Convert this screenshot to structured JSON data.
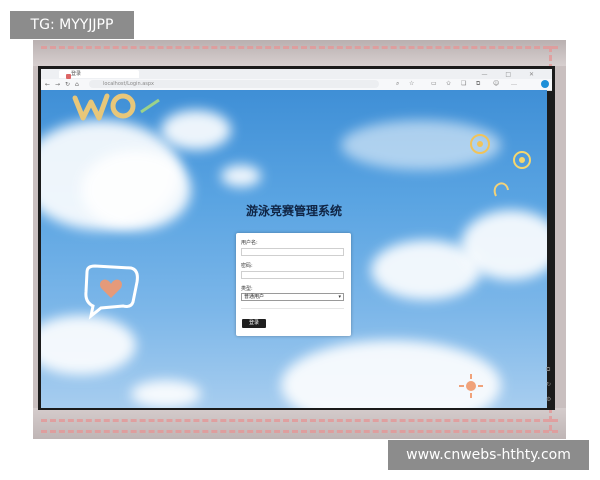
{
  "badge": {
    "text": "TG: MYYJJPP"
  },
  "watermark": {
    "text": "www.cnwebs-hthty.com"
  },
  "browser": {
    "tab_title": "登录",
    "address_text": "localhost/Login.aspx",
    "window_controls": [
      "—",
      "□",
      "✕"
    ],
    "toolbar_icons": [
      "search-icon",
      "star-icon",
      "reader-icon",
      "favorites-icon",
      "collections-icon",
      "extensions-icon",
      "profile-icon",
      "more-icon"
    ]
  },
  "page": {
    "title": "游泳竞赛管理系统",
    "login": {
      "username_label": "用户名:",
      "password_label": "密码:",
      "type_label": "类型:",
      "type_selected": "普通用户",
      "submit_label": "登录"
    }
  },
  "stickers": [
    "wo-text-sticker",
    "heart-bubble-sticker",
    "flower-sticker"
  ],
  "colors": {
    "badge_bg": "#8c8c8c",
    "dash": "#e39a9a",
    "sky": "#5aa4e2",
    "title_text": "#0f2444",
    "button_bg": "#1f1f1f"
  }
}
